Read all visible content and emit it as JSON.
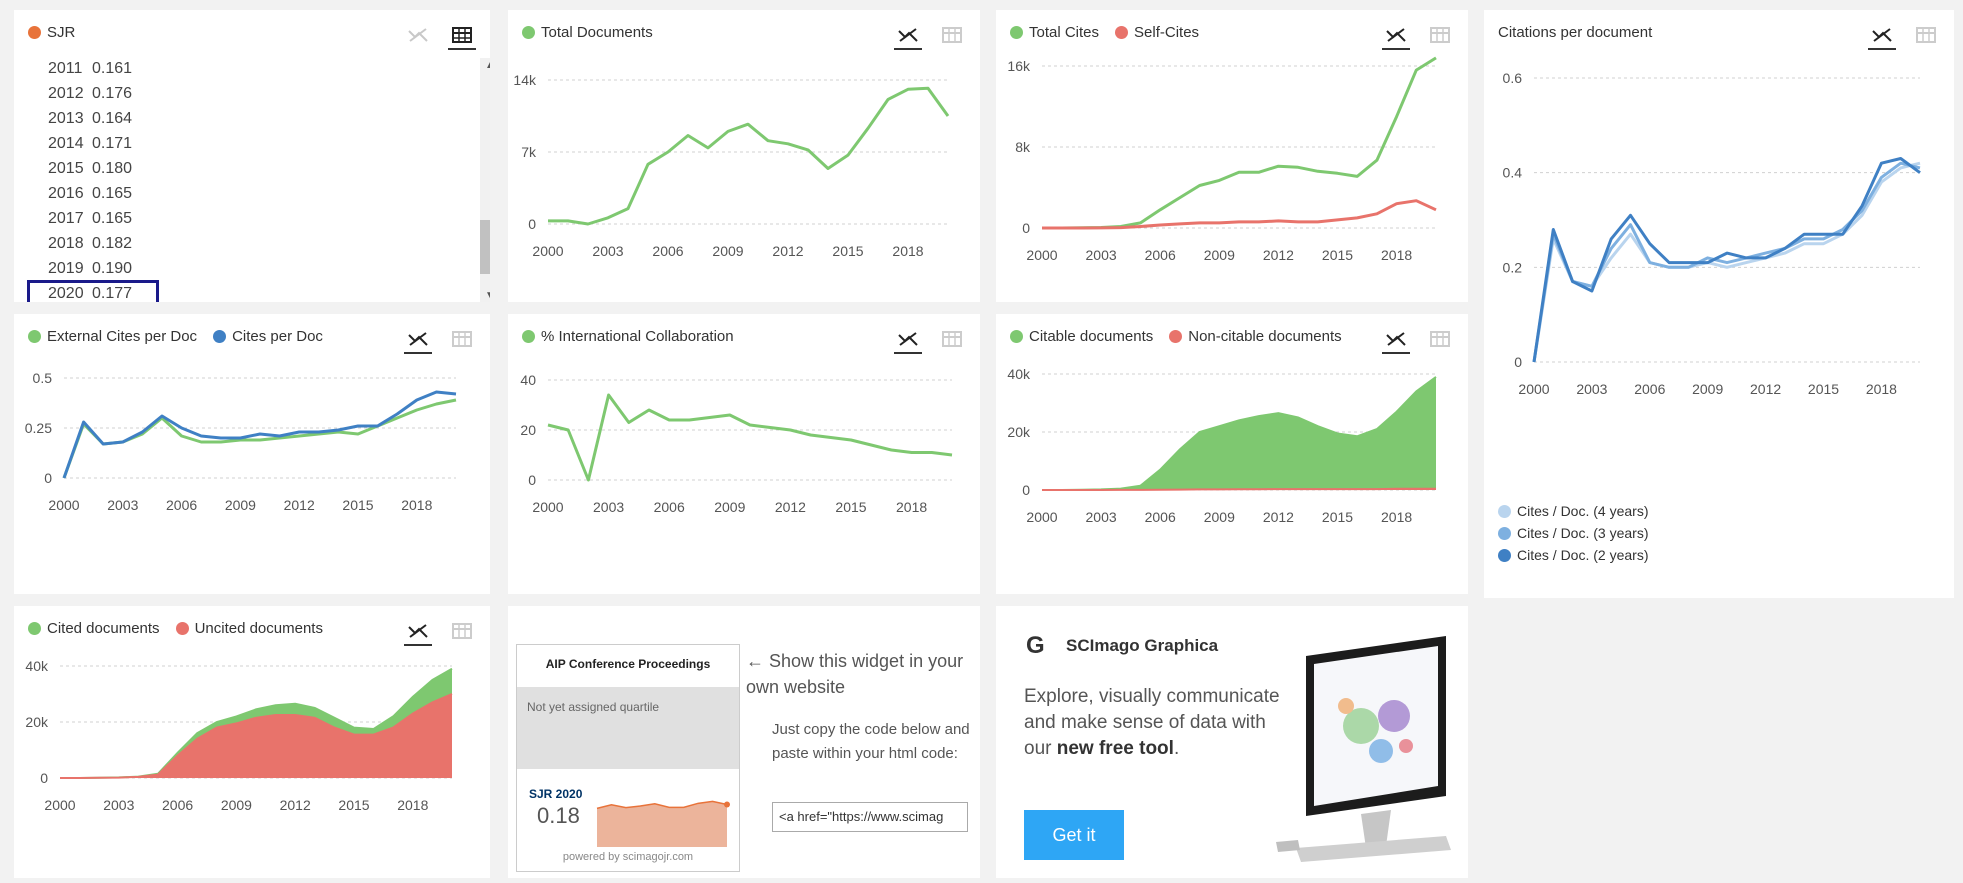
{
  "colors": {
    "green": "#7ec870",
    "red": "#e8736b",
    "orange": "#e8733a",
    "blue": "#3f80c4",
    "blue_mid": "#7eb0e0",
    "blue_light": "#b9d4ee"
  },
  "cards": {
    "sjr": {
      "legend": "SJR",
      "rows": [
        {
          "year": "2011",
          "value": "0.161"
        },
        {
          "year": "2012",
          "value": "0.176"
        },
        {
          "year": "2013",
          "value": "0.164"
        },
        {
          "year": "2014",
          "value": "0.171"
        },
        {
          "year": "2015",
          "value": "0.180"
        },
        {
          "year": "2016",
          "value": "0.165"
        },
        {
          "year": "2017",
          "value": "0.165"
        },
        {
          "year": "2018",
          "value": "0.182"
        },
        {
          "year": "2019",
          "value": "0.190"
        },
        {
          "year": "2020",
          "value": "0.177"
        }
      ]
    },
    "total_documents": {
      "legend": [
        "Total Documents"
      ]
    },
    "total_cites": {
      "legend": [
        "Total Cites",
        "Self-Cites"
      ]
    },
    "citations_per_doc": {
      "legend": [
        "Citations per document"
      ],
      "bottom_legend": [
        "Cites / Doc. (4 years)",
        "Cites / Doc. (3 years)",
        "Cites / Doc. (2 years)"
      ]
    },
    "external_cites": {
      "legend": [
        "External Cites per Doc",
        "Cites per Doc"
      ]
    },
    "intl_collab": {
      "legend": [
        "% International Collaboration"
      ]
    },
    "citable": {
      "legend": [
        "Citable documents",
        "Non-citable documents"
      ]
    },
    "cited": {
      "legend": [
        "Cited documents",
        "Uncited documents"
      ]
    },
    "widget": {
      "box_title": "AIP Conference Proceedings",
      "quartile": "Not yet assigned quartile",
      "sjr_label": "SJR 2020",
      "sjr_value": "0.18",
      "powered": "powered by scimagojr.com",
      "arrow_text": "← Show this widget in your own website",
      "instructions": "Just copy the code below and paste within your html code:",
      "code": "<a href=\"https://www.scimag"
    },
    "graphica": {
      "logo": "G",
      "title": "SCImago Graphica",
      "desc_pre": "Explore, visually communicate and make sense of data with our ",
      "desc_bold": "new free tool",
      "desc_post": ".",
      "button": "Get it"
    }
  },
  "chart_data": [
    {
      "id": "total_documents",
      "type": "line",
      "x": [
        2000,
        2001,
        2002,
        2003,
        2004,
        2005,
        2006,
        2007,
        2008,
        2009,
        2010,
        2011,
        2012,
        2013,
        2014,
        2015,
        2016,
        2017,
        2018,
        2019,
        2020
      ],
      "series": [
        {
          "name": "Total Documents",
          "values": [
            300,
            300,
            0,
            600,
            1500,
            5800,
            7000,
            8600,
            7400,
            9000,
            9700,
            8100,
            7800,
            7200,
            5400,
            6700,
            9300,
            12100,
            13100,
            13200,
            10500
          ]
        }
      ],
      "xticks": [
        2000,
        2003,
        2006,
        2009,
        2012,
        2015,
        2018
      ],
      "yticks": [
        {
          "v": 0,
          "label": "0"
        },
        {
          "v": 7000,
          "label": "7k"
        },
        {
          "v": 14000,
          "label": "14k"
        }
      ],
      "ylim": [
        0,
        14000
      ]
    },
    {
      "id": "total_cites",
      "type": "line",
      "x": [
        2000,
        2001,
        2002,
        2003,
        2004,
        2005,
        2006,
        2007,
        2008,
        2009,
        2010,
        2011,
        2012,
        2013,
        2014,
        2015,
        2016,
        2017,
        2018,
        2019,
        2020
      ],
      "series": [
        {
          "name": "Total Cites",
          "values": [
            0,
            0,
            20,
            50,
            150,
            500,
            1800,
            3000,
            4200,
            4700,
            5500,
            5500,
            6100,
            6000,
            5600,
            5400,
            5100,
            6700,
            11000,
            15600,
            16800
          ]
        },
        {
          "name": "Self-Cites",
          "values": [
            0,
            0,
            0,
            10,
            40,
            150,
            300,
            400,
            500,
            500,
            600,
            600,
            700,
            600,
            600,
            800,
            1000,
            1400,
            2400,
            2700,
            1800
          ]
        }
      ],
      "xticks": [
        2000,
        2003,
        2006,
        2009,
        2012,
        2015,
        2018
      ],
      "yticks": [
        {
          "v": 0,
          "label": "0"
        },
        {
          "v": 8000,
          "label": "8k"
        },
        {
          "v": 16000,
          "label": "16k"
        }
      ],
      "ylim": [
        0,
        16000
      ]
    },
    {
      "id": "citations_per_doc",
      "type": "line",
      "x": [
        2000,
        2001,
        2002,
        2003,
        2004,
        2005,
        2006,
        2007,
        2008,
        2009,
        2010,
        2011,
        2012,
        2013,
        2014,
        2015,
        2016,
        2017,
        2018,
        2019,
        2020
      ],
      "series": [
        {
          "name": "Cites / Doc. (4 years)",
          "values": [
            0,
            0.26,
            0.17,
            0.16,
            0.22,
            0.27,
            0.21,
            0.2,
            0.2,
            0.21,
            0.2,
            0.21,
            0.22,
            0.23,
            0.25,
            0.25,
            0.27,
            0.31,
            0.38,
            0.41,
            0.42
          ]
        },
        {
          "name": "Cites / Doc. (3 years)",
          "values": [
            0,
            0.27,
            0.17,
            0.16,
            0.24,
            0.29,
            0.21,
            0.2,
            0.2,
            0.22,
            0.21,
            0.22,
            0.23,
            0.24,
            0.26,
            0.26,
            0.28,
            0.32,
            0.39,
            0.42,
            0.41
          ]
        },
        {
          "name": "Cites / Doc. (2 years)",
          "values": [
            0,
            0.28,
            0.17,
            0.15,
            0.26,
            0.31,
            0.25,
            0.21,
            0.21,
            0.21,
            0.23,
            0.22,
            0.22,
            0.24,
            0.27,
            0.27,
            0.27,
            0.33,
            0.42,
            0.43,
            0.4
          ]
        }
      ],
      "xticks": [
        2000,
        2003,
        2006,
        2009,
        2012,
        2015,
        2018
      ],
      "yticks": [
        {
          "v": 0,
          "label": "0"
        },
        {
          "v": 0.2,
          "label": "0.2"
        },
        {
          "v": 0.4,
          "label": "0.4"
        },
        {
          "v": 0.6,
          "label": "0.6"
        }
      ],
      "ylim": [
        0,
        0.6
      ]
    },
    {
      "id": "external_cites",
      "type": "line",
      "x": [
        2000,
        2001,
        2002,
        2003,
        2004,
        2005,
        2006,
        2007,
        2008,
        2009,
        2010,
        2011,
        2012,
        2013,
        2014,
        2015,
        2016,
        2017,
        2018,
        2019,
        2020
      ],
      "series": [
        {
          "name": "External Cites per Doc",
          "values": [
            0,
            0.27,
            0.17,
            0.18,
            0.22,
            0.3,
            0.21,
            0.18,
            0.18,
            0.19,
            0.19,
            0.2,
            0.21,
            0.22,
            0.23,
            0.22,
            0.26,
            0.3,
            0.34,
            0.37,
            0.39
          ]
        },
        {
          "name": "Cites per Doc",
          "values": [
            0,
            0.28,
            0.17,
            0.18,
            0.23,
            0.31,
            0.25,
            0.21,
            0.2,
            0.2,
            0.22,
            0.21,
            0.23,
            0.23,
            0.24,
            0.26,
            0.26,
            0.32,
            0.39,
            0.43,
            0.42
          ]
        }
      ],
      "xticks": [
        2000,
        2003,
        2006,
        2009,
        2012,
        2015,
        2018
      ],
      "yticks": [
        {
          "v": 0,
          "label": "0"
        },
        {
          "v": 0.25,
          "label": "0.25"
        },
        {
          "v": 0.5,
          "label": "0.5"
        }
      ],
      "ylim": [
        0,
        0.5
      ]
    },
    {
      "id": "intl_collab",
      "type": "line",
      "x": [
        2000,
        2001,
        2002,
        2003,
        2004,
        2005,
        2006,
        2007,
        2008,
        2009,
        2010,
        2011,
        2012,
        2013,
        2014,
        2015,
        2016,
        2017,
        2018,
        2019,
        2020
      ],
      "series": [
        {
          "name": "% International Collaboration",
          "values": [
            22,
            20,
            0,
            34,
            23,
            28,
            24,
            24,
            25,
            26,
            22,
            21,
            20,
            18,
            17,
            16,
            14,
            12,
            11,
            11,
            10
          ]
        }
      ],
      "xticks": [
        2000,
        2003,
        2006,
        2009,
        2012,
        2015,
        2018
      ],
      "yticks": [
        {
          "v": 0,
          "label": "0"
        },
        {
          "v": 20,
          "label": "20"
        },
        {
          "v": 40,
          "label": "40"
        }
      ],
      "ylim": [
        0,
        40
      ]
    },
    {
      "id": "citable",
      "type": "area",
      "x": [
        2000,
        2001,
        2002,
        2003,
        2004,
        2005,
        2006,
        2007,
        2008,
        2009,
        2010,
        2011,
        2012,
        2013,
        2014,
        2015,
        2016,
        2017,
        2018,
        2019,
        2020
      ],
      "series": [
        {
          "name": "Citable documents",
          "values": [
            0,
            0,
            100,
            200,
            500,
            1500,
            7000,
            14000,
            20000,
            22000,
            24000,
            25500,
            26500,
            25000,
            22000,
            19500,
            18500,
            21000,
            27000,
            34000,
            39000
          ]
        },
        {
          "name": "Non-citable documents",
          "values": [
            0,
            0,
            0,
            10,
            20,
            50,
            100,
            150,
            200,
            200,
            250,
            250,
            300,
            300,
            300,
            300,
            300,
            300,
            400,
            400,
            400
          ]
        }
      ],
      "xticks": [
        2000,
        2003,
        2006,
        2009,
        2012,
        2015,
        2018
      ],
      "yticks": [
        {
          "v": 0,
          "label": "0"
        },
        {
          "v": 20000,
          "label": "20k"
        },
        {
          "v": 40000,
          "label": "40k"
        }
      ],
      "ylim": [
        0,
        40000
      ]
    },
    {
      "id": "cited",
      "type": "area",
      "x": [
        2000,
        2001,
        2002,
        2003,
        2004,
        2005,
        2006,
        2007,
        2008,
        2009,
        2010,
        2011,
        2012,
        2013,
        2014,
        2015,
        2016,
        2017,
        2018,
        2019,
        2020
      ],
      "series": [
        {
          "name": "Cited documents",
          "values": [
            0,
            0,
            100,
            200,
            500,
            1500,
            9000,
            16000,
            20000,
            22000,
            24500,
            26000,
            26500,
            25000,
            21500,
            18000,
            17500,
            22000,
            29000,
            35000,
            39000
          ]
        },
        {
          "name": "Uncited documents",
          "values": [
            0,
            0,
            80,
            150,
            400,
            1200,
            8000,
            14000,
            18000,
            19500,
            21500,
            22500,
            22500,
            21500,
            18000,
            15500,
            15500,
            18000,
            23000,
            27000,
            30000
          ]
        }
      ],
      "xticks": [
        2000,
        2003,
        2006,
        2009,
        2012,
        2015,
        2018
      ],
      "yticks": [
        {
          "v": 0,
          "label": "0"
        },
        {
          "v": 20000,
          "label": "20k"
        },
        {
          "v": 40000,
          "label": "40k"
        }
      ],
      "ylim": [
        0,
        40000
      ]
    },
    {
      "id": "widget_sjr",
      "type": "area",
      "x": [
        2011,
        2012,
        2013,
        2014,
        2015,
        2016,
        2017,
        2018,
        2019,
        2020
      ],
      "series": [
        {
          "name": "SJR",
          "values": [
            0.161,
            0.176,
            0.164,
            0.171,
            0.18,
            0.165,
            0.165,
            0.182,
            0.19,
            0.177
          ]
        }
      ],
      "ylim": [
        0,
        0.2
      ]
    }
  ]
}
